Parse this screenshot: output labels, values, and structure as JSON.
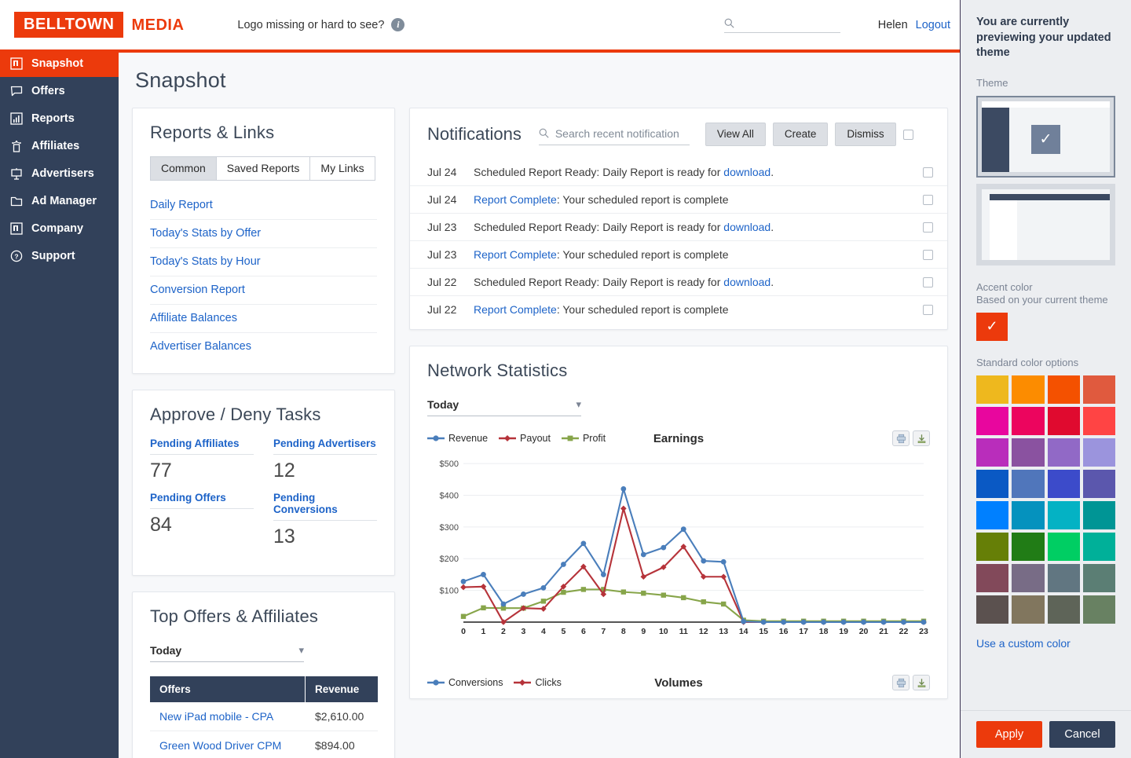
{
  "header": {
    "logo_primary": "BELLTOWN",
    "logo_secondary": "MEDIA",
    "logo_hint": "Logo missing or hard to see?",
    "search_placeholder": "",
    "search_value": "",
    "user_name": "Helen",
    "logout_label": "Logout",
    "accent_color": "#ec3a0c"
  },
  "sidebar": {
    "items": [
      {
        "label": "Snapshot",
        "icon": "snapshot-icon",
        "active": true
      },
      {
        "label": "Offers",
        "icon": "offers-icon",
        "active": false
      },
      {
        "label": "Reports",
        "icon": "reports-icon",
        "active": false
      },
      {
        "label": "Affiliates",
        "icon": "affiliates-icon",
        "active": false
      },
      {
        "label": "Advertisers",
        "icon": "advertisers-icon",
        "active": false
      },
      {
        "label": "Ad Manager",
        "icon": "folder-icon",
        "active": false
      },
      {
        "label": "Company",
        "icon": "company-icon",
        "active": false
      },
      {
        "label": "Support",
        "icon": "question-circle-icon",
        "active": false
      }
    ]
  },
  "page": {
    "title": "Snapshot"
  },
  "reports_links": {
    "title": "Reports & Links",
    "tabs": [
      {
        "label": "Common",
        "active": true
      },
      {
        "label": "Saved Reports",
        "active": false
      },
      {
        "label": "My Links",
        "active": false
      }
    ],
    "links": [
      "Daily Report",
      "Today's Stats by Offer",
      "Today's Stats by Hour",
      "Conversion Report",
      "Affiliate Balances",
      "Advertiser Balances"
    ]
  },
  "approve_deny": {
    "title": "Approve / Deny Tasks",
    "cells": [
      {
        "label": "Pending Affiliates",
        "value": "77"
      },
      {
        "label": "Pending Advertisers",
        "value": "12"
      },
      {
        "label": "Pending Offers",
        "value": "84"
      },
      {
        "label": "Pending Conversions",
        "value": "13"
      }
    ]
  },
  "top_offers": {
    "title": "Top Offers & Affiliates",
    "period": "Today",
    "columns": [
      "Offers",
      "Revenue"
    ],
    "rows": [
      {
        "offer": "New iPad mobile - CPA",
        "revenue": "$2,610.00"
      },
      {
        "offer": "Green Wood Driver CPM",
        "revenue": "$894.00"
      }
    ]
  },
  "notifications": {
    "title": "Notifications",
    "search_placeholder": "Search recent notification",
    "search_value": "",
    "buttons": [
      "View All",
      "Create",
      "Dismiss"
    ],
    "rows": [
      {
        "date": "Jul 24",
        "lead": "",
        "text": "Scheduled Report Ready: Daily Report is ready for ",
        "link": "download",
        "tail": "."
      },
      {
        "date": "Jul 24",
        "lead": "Report Complete",
        "text": ": Your scheduled report is complete",
        "link": "",
        "tail": ""
      },
      {
        "date": "Jul 23",
        "lead": "",
        "text": "Scheduled Report Ready: Daily Report is ready for ",
        "link": "download",
        "tail": "."
      },
      {
        "date": "Jul 23",
        "lead": "Report Complete",
        "text": ": Your scheduled report is complete",
        "link": "",
        "tail": ""
      },
      {
        "date": "Jul 22",
        "lead": "",
        "text": "Scheduled Report Ready: Daily Report is ready for ",
        "link": "download",
        "tail": "."
      },
      {
        "date": "Jul 22",
        "lead": "Report Complete",
        "text": ": Your scheduled report is complete",
        "link": "",
        "tail": ""
      }
    ]
  },
  "network_statistics": {
    "title": "Network Statistics",
    "period": "Today"
  },
  "chart_data": [
    {
      "type": "line",
      "title": "Earnings",
      "xlabel": "",
      "ylabel": "",
      "x": [
        0,
        1,
        2,
        3,
        4,
        5,
        6,
        7,
        8,
        9,
        10,
        11,
        12,
        13,
        14,
        15,
        16,
        17,
        18,
        19,
        20,
        21,
        22,
        23
      ],
      "categories": [
        "0",
        "1",
        "2",
        "3",
        "4",
        "5",
        "6",
        "7",
        "8",
        "9",
        "10",
        "11",
        "12",
        "13",
        "14",
        "15",
        "16",
        "17",
        "18",
        "19",
        "20",
        "21",
        "22",
        "23"
      ],
      "ytick_labels": [
        "$100",
        "$200",
        "$300",
        "$400",
        "$500"
      ],
      "ylim": [
        0,
        520
      ],
      "grid": true,
      "legend_position": "top-left",
      "series": [
        {
          "name": "Revenue",
          "color": "#4a7ebb",
          "values": [
            128,
            150,
            57,
            88,
            108,
            182,
            248,
            150,
            420,
            213,
            235,
            293,
            193,
            190,
            2,
            0,
            0,
            0,
            0,
            0,
            0,
            0,
            0,
            0
          ]
        },
        {
          "name": "Payout",
          "color": "#b6333a",
          "values": [
            110,
            112,
            0,
            44,
            42,
            112,
            175,
            88,
            358,
            143,
            173,
            238,
            143,
            143,
            0,
            0,
            0,
            0,
            0,
            0,
            0,
            0,
            0,
            0
          ]
        },
        {
          "name": "Profit",
          "color": "#87a54a",
          "values": [
            18,
            45,
            44,
            44,
            66,
            94,
            103,
            103,
            95,
            91,
            85,
            77,
            64,
            57,
            6,
            3,
            3,
            3,
            3,
            3,
            3,
            3,
            3,
            3
          ]
        }
      ]
    },
    {
      "type": "line",
      "title": "Volumes",
      "legend_position": "top-left",
      "series": [
        {
          "name": "Conversions",
          "color": "#4a7ebb",
          "values": []
        },
        {
          "name": "Clicks",
          "color": "#b6333a",
          "values": []
        }
      ]
    }
  ],
  "theme_panel": {
    "heading": "You are currently previewing your updated theme",
    "theme_label": "Theme",
    "accent_label": "Accent color",
    "accent_sub": "Based on your current theme",
    "accent_current": "#ec3a0c",
    "standard_label": "Standard color options",
    "custom_link": "Use a custom color",
    "apply_label": "Apply",
    "cancel_label": "Cancel",
    "swatches": [
      "#eeb81e",
      "#fc8c00",
      "#f45100",
      "#e05a3e",
      "#e8069e",
      "#ec055e",
      "#e00a2f",
      "#ff4444",
      "#b92dbb",
      "#8a52a0",
      "#9169c6",
      "#9b94dd",
      "#0a59c4",
      "#5076bb",
      "#3c4bca",
      "#5b57ad",
      "#0080ff",
      "#0592be",
      "#04b2c4",
      "#009595",
      "#667f07",
      "#217c16",
      "#00ce63",
      "#00b099",
      "#82495a",
      "#786c86",
      "#617681",
      "#5b7e74",
      "#5b514f",
      "#81765e",
      "#5e6458",
      "#688162"
    ]
  }
}
